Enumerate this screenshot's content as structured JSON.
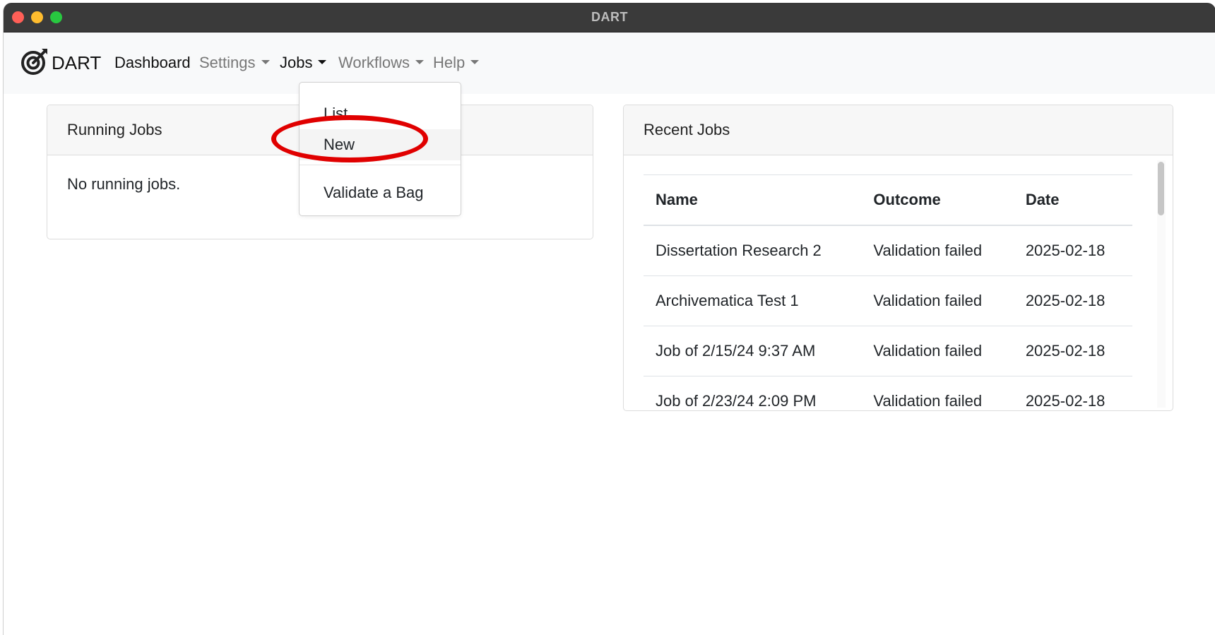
{
  "window": {
    "title": "DART"
  },
  "navbar": {
    "brand": "DART",
    "items": [
      {
        "label": "Dashboard"
      },
      {
        "label": "Settings"
      },
      {
        "label": "Jobs"
      },
      {
        "label": "Workflows"
      },
      {
        "label": "Help"
      }
    ]
  },
  "jobs_menu": {
    "items": [
      {
        "label": "List"
      },
      {
        "label": "New"
      },
      {
        "label": "Validate a Bag"
      }
    ]
  },
  "running_jobs": {
    "title": "Running Jobs",
    "empty_text": "No running jobs."
  },
  "recent_jobs": {
    "title": "Recent Jobs",
    "columns": [
      "Name",
      "Outcome",
      "Date"
    ],
    "rows": [
      {
        "name": "Dissertation Research 2",
        "outcome": "Validation failed",
        "date": "2025-02-18"
      },
      {
        "name": "Archivematica Test 1",
        "outcome": "Validation failed",
        "date": "2025-02-18"
      },
      {
        "name": "Job of 2/15/24 9:37 AM",
        "outcome": "Validation failed",
        "date": "2025-02-18"
      },
      {
        "name": "Job of 2/23/24 2:09 PM",
        "outcome": "Validation failed",
        "date": "2025-02-18"
      }
    ]
  },
  "colors": {
    "titlebar": "#3a3a3a",
    "navbar_bg": "#f8f9fa",
    "annotation": "#e00000",
    "close": "#ff5f57",
    "minimize": "#febc2e",
    "zoom": "#28c840"
  }
}
